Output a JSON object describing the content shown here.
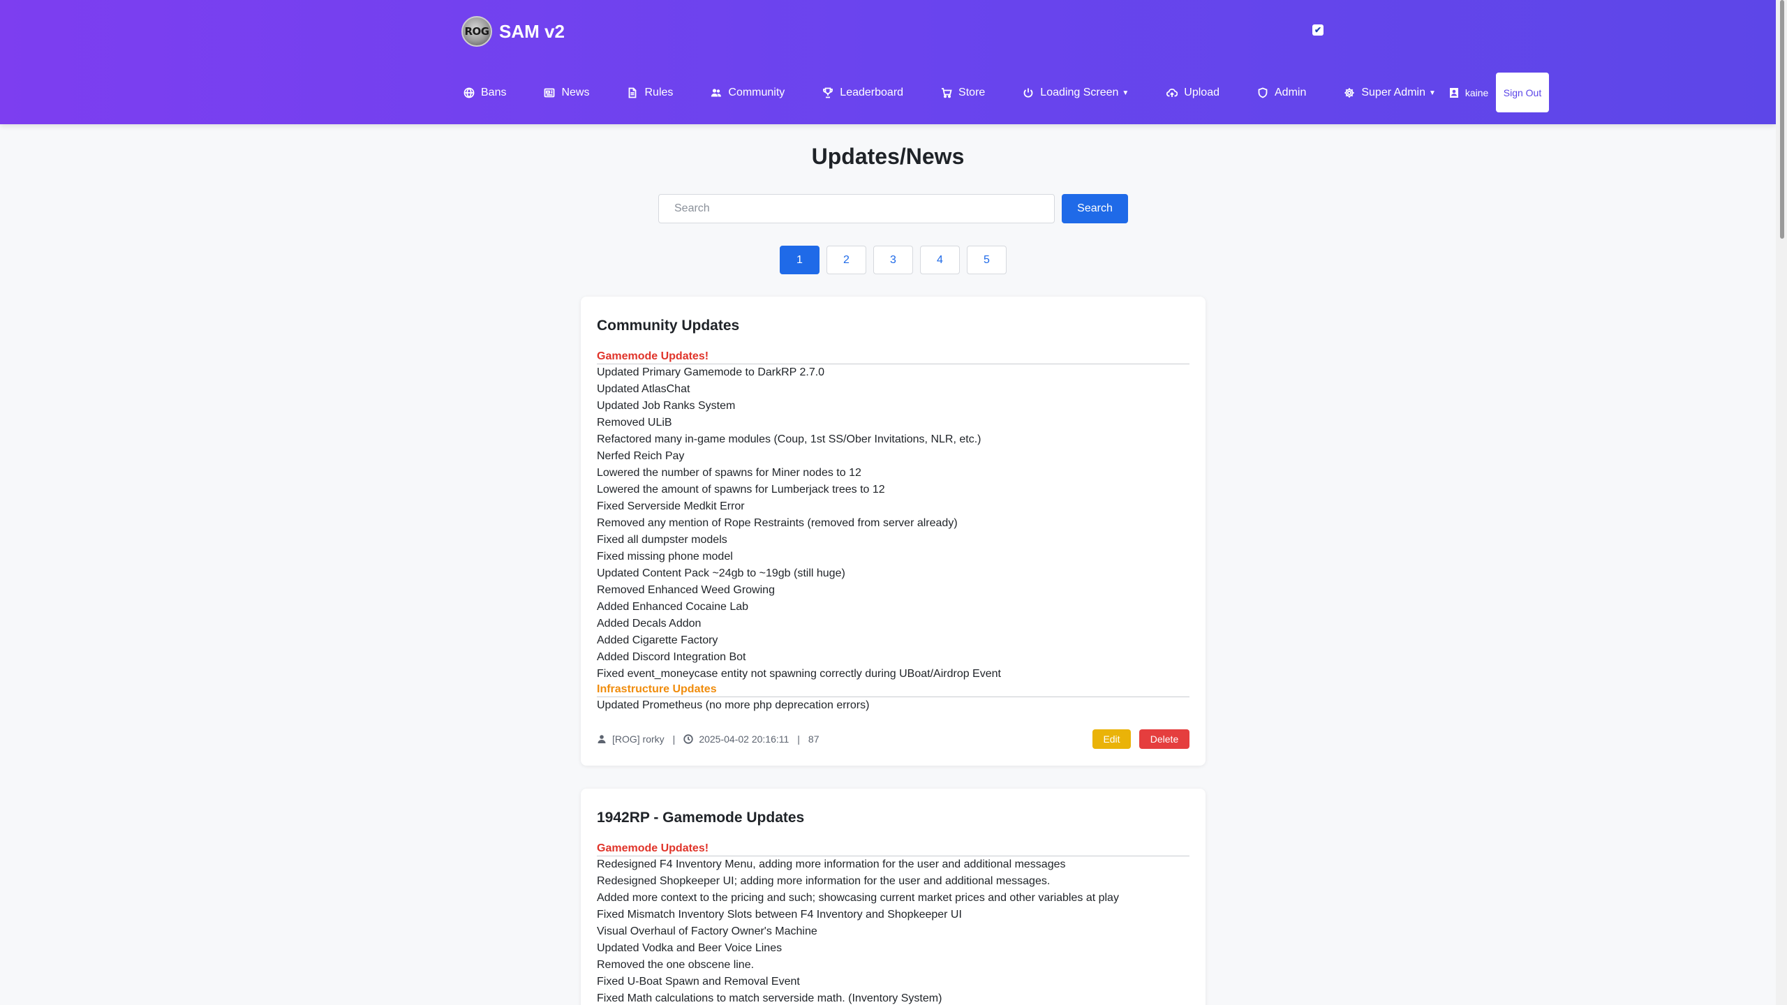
{
  "brand": {
    "logo_text": "ROG",
    "title": "SAM v2",
    "check_glyph": "✔"
  },
  "nav": {
    "items": [
      {
        "label": "Bans",
        "icon": "globe-icon"
      },
      {
        "label": "News",
        "icon": "newspaper-icon"
      },
      {
        "label": "Rules",
        "icon": "document-icon"
      },
      {
        "label": "Community",
        "icon": "users-icon"
      },
      {
        "label": "Leaderboard",
        "icon": "trophy-icon"
      },
      {
        "label": "Store",
        "icon": "cart-icon"
      },
      {
        "label": "Loading Screen",
        "icon": "power-icon",
        "dropdown": true
      },
      {
        "label": "Upload",
        "icon": "cloud-upload-icon"
      },
      {
        "label": "Admin",
        "icon": "shield-icon"
      },
      {
        "label": "Super Admin",
        "icon": "gear-icon",
        "dropdown": true
      }
    ],
    "user": "kaine",
    "sign_out": "Sign Out"
  },
  "main": {
    "title": "Updates/News",
    "search": {
      "placeholder": "Search",
      "value": "",
      "button": "Search"
    },
    "pagination": [
      "1",
      "2",
      "3",
      "4",
      "5"
    ],
    "active_page": "1"
  },
  "posts": [
    {
      "title": "Community Updates",
      "sections": [
        {
          "heading": "Gamemode Updates!",
          "color": "#e0342a",
          "lines": [
            "Updated Primary Gamemode to DarkRP 2.7.0",
            "Updated AtlasChat",
            "Updated Job Ranks System",
            "Removed ULiB",
            "Refactored many in-game modules (Coup, 1st SS/Ober Invitations, NLR, etc.)",
            "Nerfed Reich Pay",
            "Lowered the number of spawns for Miner nodes to 12",
            "Lowered the amount of spawns for Lumberjack trees to 12",
            "Fixed Serverside Medkit Error",
            "Removed any mention of Rope Restraints (removed from server already)",
            "Fixed all dumpster models",
            "Fixed missing phone model",
            "Updated Content Pack ~24gb to ~19gb (still huge)",
            "Removed Enhanced Weed Growing",
            "Added Enhanced Cocaine Lab",
            "Added Decals Addon",
            "Added Cigarette Factory",
            "Added Discord Integration Bot",
            "Fixed event_moneycase entity not spawning correctly during UBoat/Airdrop Event"
          ]
        },
        {
          "heading": "Infrastructure Updates",
          "color": "#f08c0c",
          "lines": [
            "Updated Prometheus (no more php deprecation errors)"
          ]
        }
      ],
      "author": "[ROG] rorky",
      "date": "2025-04-02 20:16:11",
      "views": "87",
      "edit_label": "Edit",
      "delete_label": "Delete"
    },
    {
      "title": "1942RP - Gamemode Updates",
      "sections": [
        {
          "heading": "Gamemode Updates!",
          "color": "#e0342a",
          "lines": [
            "Redesigned F4 Inventory Menu, adding more information for the user and additional messages",
            "Redesigned Shopkeeper UI; adding more information for the user and additional messages.",
            "Added more context to the pricing and such; showcasing current market prices and other variables at play",
            "Fixed Mismatch Inventory Slots between F4 Inventory and Shopkeeper UI",
            "Visual Overhaul of Factory Owner's Machine",
            "Updated Vodka and Beer Voice Lines",
            "Removed the one obscene line.",
            "Fixed U-Boat Spawn and Removal Event",
            "Fixed Math calculations to match serverside math. (Inventory System)"
          ]
        }
      ]
    }
  ]
}
